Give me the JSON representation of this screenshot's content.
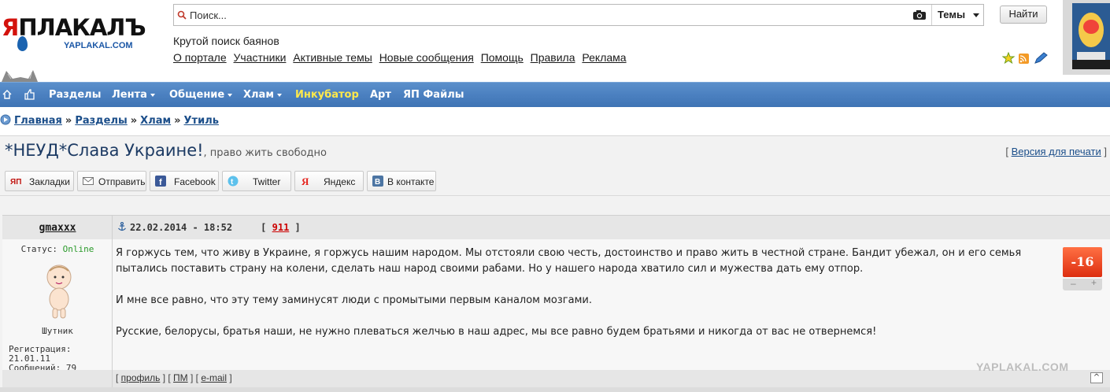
{
  "header": {
    "logo_text_accent": "Я",
    "logo_text_main": "ПЛАКАЛЪ",
    "logo_url_text": "YAPLAKAL.COM",
    "tagline": "Крутой поиск баянов",
    "top_links": [
      "О портале",
      "Участники",
      "Активные темы",
      "Новые сообщения",
      "Помощь",
      "Правила",
      "Реклама"
    ]
  },
  "search": {
    "placeholder": "Поиск...",
    "scope": "Темы",
    "button": "Найти"
  },
  "nav": {
    "items": [
      {
        "label": "Разделы",
        "dropdown": false
      },
      {
        "label": "Лента",
        "dropdown": true
      },
      {
        "label": "Общение",
        "dropdown": true
      },
      {
        "label": "Хлам",
        "dropdown": true
      },
      {
        "label": "Инкубатор",
        "dropdown": false,
        "color": "#ffe94b"
      },
      {
        "label": "Арт",
        "dropdown": false
      },
      {
        "label": "ЯП Файлы",
        "dropdown": false
      }
    ]
  },
  "breadcrumb": {
    "items": [
      "Главная",
      "Разделы",
      "Хлам",
      "Утиль"
    ],
    "separator": "»"
  },
  "topic": {
    "title": "*НЕУД*Слава Украине!",
    "description": ", право жить свободно",
    "print_link": "Версия для печати"
  },
  "share": {
    "buttons": [
      "Закладки",
      "Отправить",
      "Facebook",
      "Twitter",
      "Яндекс",
      "В контакте"
    ]
  },
  "post": {
    "author": "gmaxxx",
    "date": "22.02.2014 - 18:52",
    "number": "911",
    "status_label": "Статус:",
    "status_value": "Online",
    "rank": "Шутник",
    "registration": "Регистрация: 21.01.11",
    "messages": "Сообщений: 79",
    "paragraphs": [
      "Я горжусь тем, что живу в Украине, я горжусь нашим народом. Мы отстояли свою честь, достоинство и право жить в честной стране. Бандит убежал, он и его семья пытались поставить страну на колени, сделать наш народ своими рабами. Но у нашего народа хватило сил и мужества дать ему отпор.",
      "И мне все равно, что эту тему заминусят люди с промытыми первым каналом мозгами.",
      "Русские, белорусы, братья наши, не нужно плеваться желчью в наш адрес, мы все равно будем братьями и никогда от вас не отвернемся!"
    ],
    "rating": "-16",
    "rating_minus": "–",
    "rating_plus": "+",
    "footer_links": [
      "профиль",
      "ПМ",
      "e-mail"
    ],
    "watermark": "YAPLAKAL.COM",
    "top_button": "^"
  },
  "colors": {
    "nav_bg": "#4a7fbf",
    "nav_highlight": "#ffe94b",
    "rating_bg": "#e23a17",
    "link_blue": "#1b4e8a",
    "logo_red": "#d3120c"
  }
}
